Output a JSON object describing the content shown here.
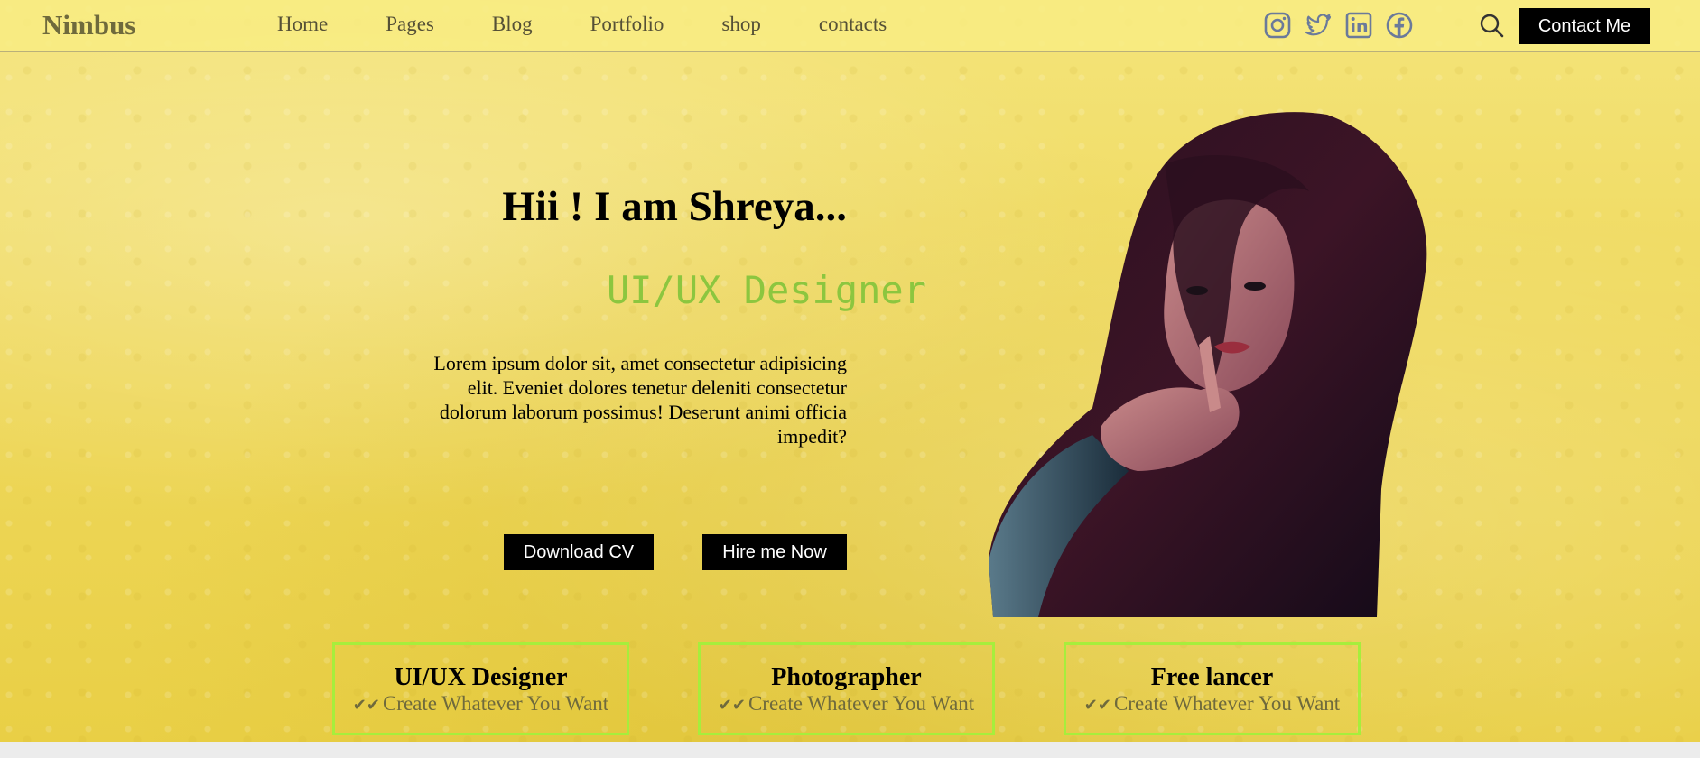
{
  "brand": "Nimbus",
  "nav": {
    "items": [
      "Home",
      "Pages",
      "Blog",
      "Portfolio",
      "shop",
      "contacts"
    ],
    "social_icons": [
      "instagram-icon",
      "twitter-icon",
      "linkedin-icon",
      "facebook-icon"
    ],
    "search_icon": "search-icon",
    "contact_button": "Contact Me"
  },
  "hero": {
    "title": "Hii ! I am Shreya...",
    "role": "UI/UX Designer",
    "description": "Lorem ipsum dolor sit, amet consectetur adipisicing elit. Eveniet dolores tenetur deleniti consectetur dolorum laborum possimus! Deserunt animi officia impedit?",
    "download_button": "Download CV",
    "hire_button": "Hire me Now"
  },
  "cards": [
    {
      "title": "UI/UX Designer",
      "subtitle": "Create Whatever You Want"
    },
    {
      "title": "Photographer",
      "subtitle": "Create Whatever You Want"
    },
    {
      "title": "Free lancer",
      "subtitle": "Create Whatever You Want"
    }
  ],
  "colors": {
    "accent_green": "#8cc63f",
    "card_border": "#a6ee3c",
    "background_yellow": "#efd95e",
    "button_black": "#000000"
  }
}
